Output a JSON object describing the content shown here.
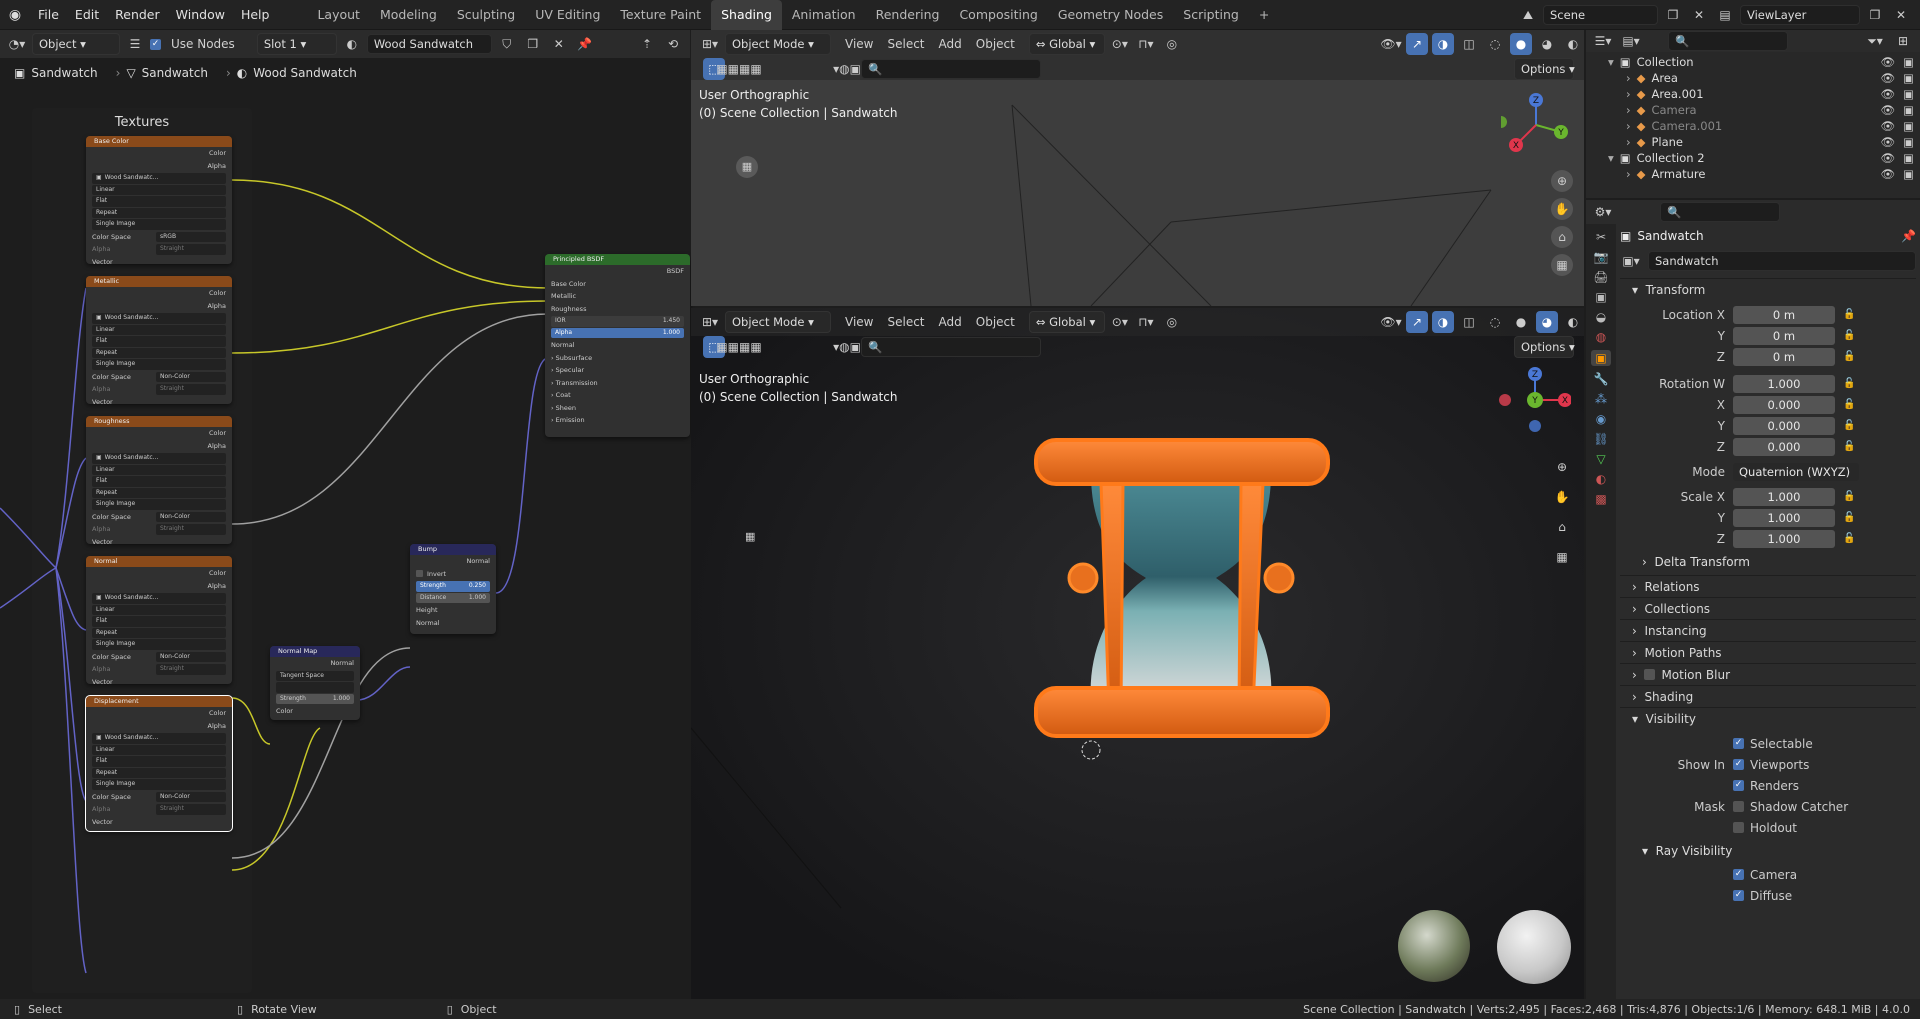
{
  "menu": {
    "items": [
      "File",
      "Edit",
      "Render",
      "Window",
      "Help"
    ]
  },
  "workspaces": {
    "tabs": [
      "Layout",
      "Modeling",
      "Sculpting",
      "UV Editing",
      "Texture Paint",
      "Shading",
      "Animation",
      "Rendering",
      "Compositing",
      "Geometry Nodes",
      "Scripting"
    ],
    "add": "+"
  },
  "scene": {
    "name": "Scene",
    "view_layer": "ViewLayer"
  },
  "node_editor": {
    "header": {
      "type": "Object",
      "use_nodes": "Use Nodes",
      "slot": "Slot 1",
      "material": "Wood Sandwatch"
    },
    "breadcrumb": [
      "Sandwatch",
      "Sandwatch",
      "Wood Sandwatch"
    ],
    "frame_label": "Textures",
    "tex_nodes": [
      {
        "title": "Base Color",
        "color_space": "sRGB",
        "alpha_mode": "Straight"
      },
      {
        "title": "Metallic",
        "color_space": "Non-Color",
        "alpha_mode": "Straight"
      },
      {
        "title": "Roughness",
        "color_space": "Non-Color",
        "alpha_mode": "Straight"
      },
      {
        "title": "Normal",
        "color_space": "Non-Color",
        "alpha_mode": "Straight"
      },
      {
        "title": "Displacement",
        "color_space": "Non-Color",
        "alpha_mode": "Straight"
      }
    ],
    "tex_common": {
      "out_color": "Color",
      "out_alpha": "Alpha",
      "image": "Wood Sandwatc...",
      "interp": "Linear",
      "proj": "Flat",
      "ext": "Repeat",
      "source": "Single Image",
      "cs_label": "Color Space",
      "alpha_label": "Alpha",
      "vector": "Vector"
    },
    "bsdf": {
      "title": "Principled BSDF",
      "out": "BSDF",
      "inputs": [
        "Base Color",
        "Metallic",
        "Roughness"
      ],
      "ior_label": "IOR",
      "ior": "1.450",
      "alpha_label": "Alpha",
      "alpha": "1.000",
      "normal": "Normal",
      "panels": [
        "Subsurface",
        "Specular",
        "Transmission",
        "Coat",
        "Sheen",
        "Emission"
      ]
    },
    "bump": {
      "title": "Bump",
      "out": "Normal",
      "invert": "Invert",
      "strength_label": "Strength",
      "strength": "0.250",
      "distance_label": "Distance",
      "distance": "1.000",
      "height": "Height",
      "normal": "Normal"
    },
    "normal_map": {
      "title": "Normal Map",
      "out": "Normal",
      "space": "Tangent Space",
      "uv": "",
      "strength_label": "Strength",
      "strength": "1.000",
      "color": "Color"
    }
  },
  "viewport_top": {
    "mode": "Object Mode",
    "menus": [
      "View",
      "Select",
      "Add",
      "Object"
    ],
    "orientation": "Global",
    "options": "Options",
    "view_name": "User Orthographic",
    "collection": "(0) Scene Collection | Sandwatch"
  },
  "viewport_main": {
    "mode": "Object Mode",
    "menus": [
      "View",
      "Select",
      "Add",
      "Object"
    ],
    "orientation": "Global",
    "options": "Options",
    "view_name": "User Orthographic",
    "collection": "(0) Scene Collection | Sandwatch"
  },
  "gizmo": {
    "x": "X",
    "y": "Y",
    "z": "Z"
  },
  "outliner": {
    "rows": [
      {
        "name": "Collection",
        "indent": 0,
        "dim": false
      },
      {
        "name": "Area",
        "indent": 1,
        "dim": false
      },
      {
        "name": "Area.001",
        "indent": 1,
        "dim": false
      },
      {
        "name": "Camera",
        "indent": 1,
        "dim": true
      },
      {
        "name": "Camera.001",
        "indent": 1,
        "dim": true
      },
      {
        "name": "Plane",
        "indent": 1,
        "dim": false
      },
      {
        "name": "Collection 2",
        "indent": 0,
        "dim": false
      },
      {
        "name": "Armature",
        "indent": 1,
        "dim": false
      }
    ]
  },
  "properties": {
    "object_name": "Sandwatch",
    "name_field": "Sandwatch",
    "transform": {
      "title": "Transform",
      "loc_label": "Location X",
      "loc": [
        "0 m",
        "0 m",
        "0 m"
      ],
      "rot_label": "Rotation W",
      "rot": [
        "1.000",
        "0.000",
        "0.000",
        "0.000"
      ],
      "mode_label": "Mode",
      "mode": "Quaternion (WXYZ)",
      "scale_label": "Scale X",
      "scale": [
        "1.000",
        "1.000",
        "1.000"
      ],
      "y": "Y",
      "z": "Z",
      "x": "X"
    },
    "delta": "Delta Transform",
    "panels": [
      "Relations",
      "Collections",
      "Instancing",
      "Motion Paths",
      "Motion Blur",
      "Shading"
    ],
    "visibility": {
      "title": "Visibility",
      "selectable": "Selectable",
      "show_in": "Show In",
      "viewports": "Viewports",
      "renders": "Renders",
      "mask": "Mask",
      "shadow_catcher": "Shadow Catcher",
      "holdout": "Holdout",
      "ray_visibility": "Ray Visibility",
      "camera": "Camera",
      "diffuse": "Diffuse"
    }
  },
  "status": {
    "select": "Select",
    "rotate": "Rotate View",
    "object": "Object",
    "info": "Scene Collection | Sandwatch | Verts:2,495 | Faces:2,468 | Tris:4,876 | Objects:1/6 | Memory: 648.1 MiB | 4.0.0"
  }
}
